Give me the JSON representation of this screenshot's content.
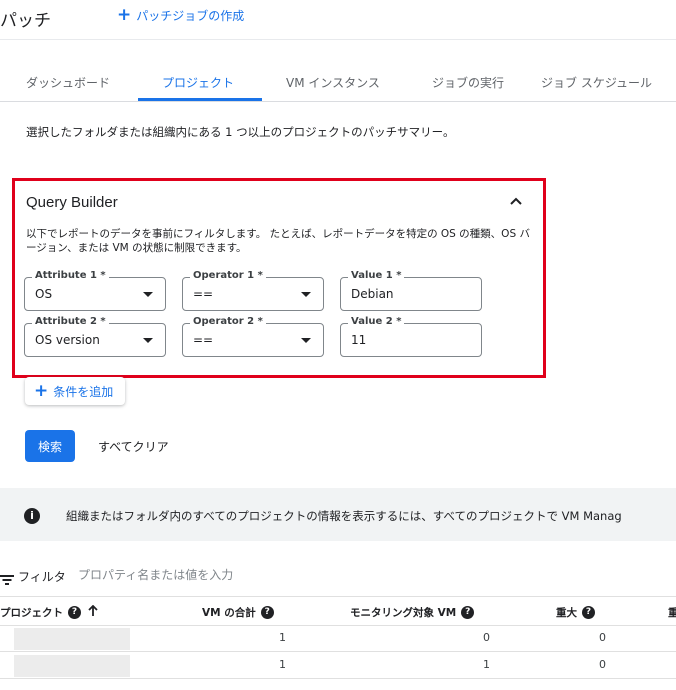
{
  "header": {
    "title": "パッチ",
    "create_link": "パッチジョブの作成"
  },
  "tabs": [
    "ダッシュボード",
    "プロジェクト",
    "VM インスタンス",
    "ジョブの実行",
    "ジョブ スケジュール"
  ],
  "active_tab": "プロジェクト",
  "description": "選択したフォルダまたは組織内にある 1 つ以上のプロジェクトのパッチサマリー。",
  "query_builder": {
    "title": "Query Builder",
    "description": "以下でレポートのデータを事前にフィルタします。 たとえば、レポートデータを特定の OS の種類、OS バージョン、または VM の状態に制限できます。",
    "rows": [
      {
        "attribute_label": "Attribute 1 *",
        "attribute_value": "OS",
        "operator_label": "Operator 1 *",
        "operator_value": "==",
        "value_label": "Value 1 *",
        "value_value": "Debian"
      },
      {
        "attribute_label": "Attribute 2 *",
        "attribute_value": "OS version",
        "operator_label": "Operator 2 *",
        "operator_value": "==",
        "value_label": "Value 2 *",
        "value_value": "11"
      }
    ],
    "highlight_color": "#e0001b"
  },
  "add_condition_label": "条件を追加",
  "search_button": "検索",
  "clear_button": "すべてクリア",
  "info_banner": {
    "text": "組織またはフォルダ内のすべてのプロジェクトの情報を表示するには、すべてのプロジェクトで VM Manag"
  },
  "filter": {
    "label": "フィルタ",
    "placeholder": "プロパティ名または値を入力"
  },
  "table": {
    "columns": [
      "プロジェクト",
      "VM の合計",
      "モニタリング対象 VM",
      "重大",
      "重"
    ],
    "rows": [
      {
        "project": "",
        "vm_total": "1",
        "monitored_vm": "0",
        "critical": "0"
      },
      {
        "project": "",
        "vm_total": "1",
        "monitored_vm": "1",
        "critical": "0"
      }
    ]
  },
  "colors": {
    "accent": "#1a73e8",
    "highlight": "#e0001b"
  }
}
